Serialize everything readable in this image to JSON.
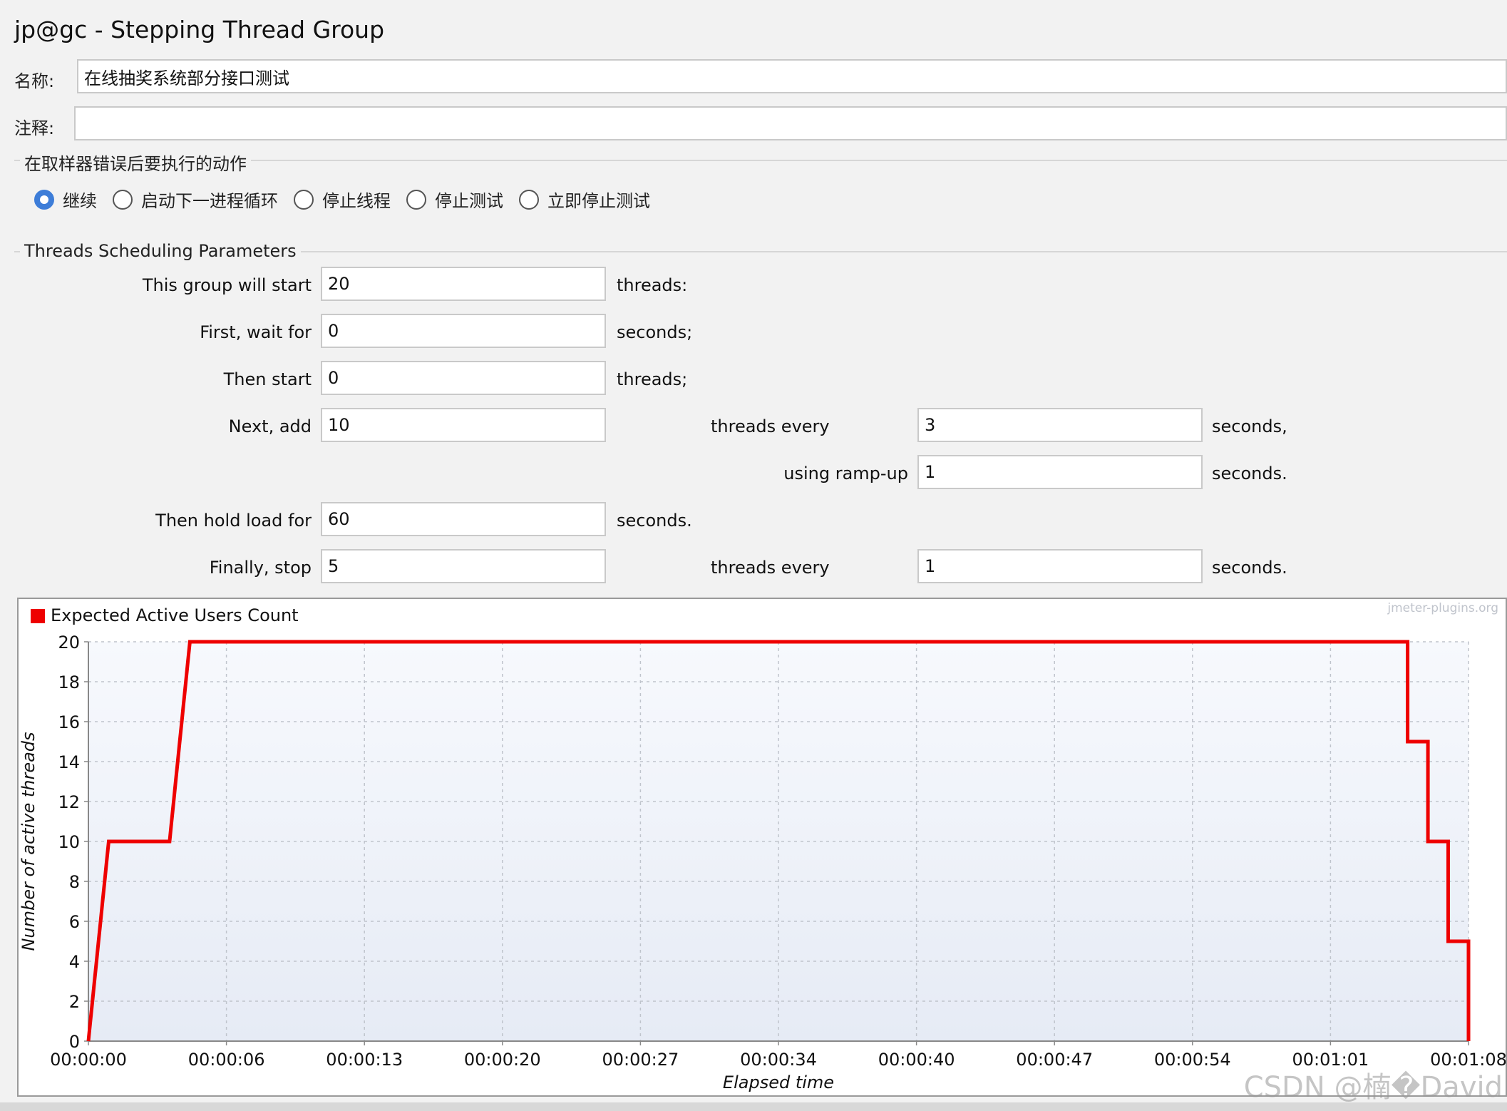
{
  "window": {
    "title": "jp@gc - Stepping Thread Group"
  },
  "form": {
    "name_label": "名称:",
    "name_value": "在线抽奖系统部分接口测试",
    "comment_label": "注释:",
    "comment_value": ""
  },
  "error_action": {
    "section_title": "在取样器错误后要执行的动作",
    "options": [
      {
        "label": "继续",
        "selected": true
      },
      {
        "label": "启动下一进程循环",
        "selected": false
      },
      {
        "label": "停止线程",
        "selected": false
      },
      {
        "label": "停止测试",
        "selected": false
      },
      {
        "label": "立即停止测试",
        "selected": false
      }
    ]
  },
  "scheduling": {
    "section_title": "Threads Scheduling Parameters",
    "start_threads": {
      "label": "This group will start",
      "value": "20",
      "suffix": "threads:"
    },
    "initial_delay": {
      "label": "First, wait for",
      "value": "0",
      "suffix": "seconds;"
    },
    "then_start": {
      "label": "Then start",
      "value": "0",
      "suffix": "threads;"
    },
    "next_add": {
      "label": "Next, add",
      "value": "10",
      "mid_label": "threads every",
      "every_value": "3",
      "suffix": "seconds,"
    },
    "ramp_up": {
      "label": "using ramp-up",
      "value": "1",
      "suffix": "seconds."
    },
    "hold_load": {
      "label": "Then hold load for",
      "value": "60",
      "suffix": "seconds."
    },
    "stop": {
      "label": "Finally, stop",
      "value": "5",
      "mid_label": "threads every",
      "every_value": "1",
      "suffix": "seconds."
    }
  },
  "chart_data": {
    "type": "line",
    "legend": "Expected Active Users Count",
    "legend_color": "#ee0000",
    "credit": "jmeter-plugins.org",
    "xlabel": "Elapsed time",
    "ylabel": "Number of active threads",
    "ylim": [
      0,
      20
    ],
    "xlim_seconds": [
      0,
      68
    ],
    "yticks": [
      "0",
      "2",
      "4",
      "6",
      "8",
      "10",
      "12",
      "14",
      "16",
      "18",
      "20"
    ],
    "xticks": [
      {
        "t": 0,
        "label": "00:00:00"
      },
      {
        "t": 6.8,
        "label": "00:00:06"
      },
      {
        "t": 13.6,
        "label": "00:00:13"
      },
      {
        "t": 20.4,
        "label": "00:00:20"
      },
      {
        "t": 27.2,
        "label": "00:00:27"
      },
      {
        "t": 34.0,
        "label": "00:00:34"
      },
      {
        "t": 40.8,
        "label": "00:00:40"
      },
      {
        "t": 47.6,
        "label": "00:00:47"
      },
      {
        "t": 54.4,
        "label": "00:00:54"
      },
      {
        "t": 61.2,
        "label": "00:01:01"
      },
      {
        "t": 68.0,
        "label": "00:01:08"
      }
    ],
    "grid": true,
    "series": [
      {
        "name": "Expected Active Users Count",
        "color": "#ee0000",
        "x": [
          0,
          0.1,
          0.2,
          0.3,
          0.4,
          0.5,
          0.6,
          0.7,
          0.8,
          0.9,
          1.0,
          4.0,
          4.1,
          4.2,
          4.3,
          4.4,
          4.5,
          4.6,
          4.7,
          4.8,
          4.9,
          5.0,
          65.0,
          65.0,
          66.0,
          66.0,
          67.0,
          67.0,
          68.0,
          68.0
        ],
        "y": [
          0,
          1,
          2,
          3,
          4,
          5,
          6,
          7,
          8,
          9,
          10,
          10,
          11,
          12,
          13,
          14,
          15,
          16,
          17,
          18,
          19,
          20,
          20,
          15,
          15,
          10,
          10,
          5,
          5,
          0
        ]
      }
    ]
  },
  "footer": {
    "watermark": "CSDN @楠�David"
  }
}
